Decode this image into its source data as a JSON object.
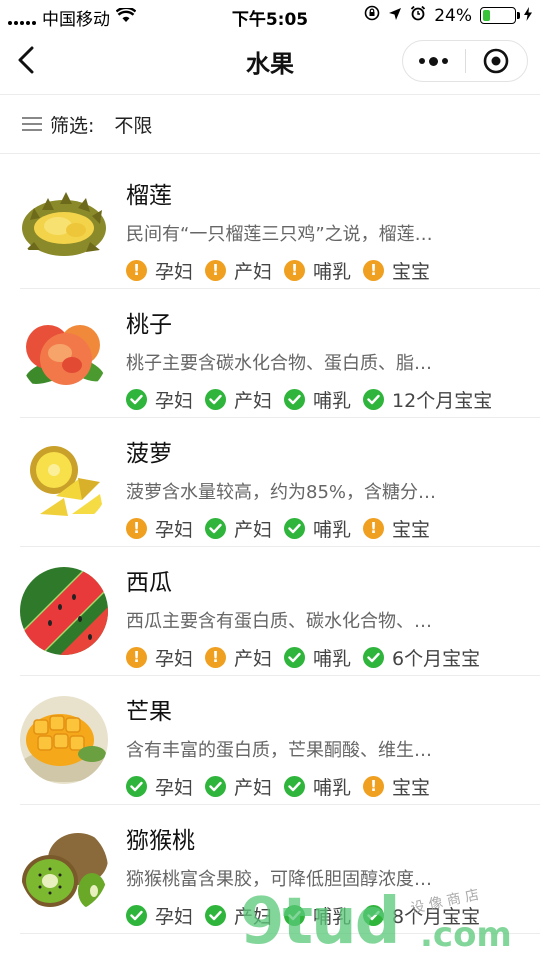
{
  "status_bar": {
    "carrier": "中国移动",
    "time": "下午5:05",
    "battery_percent": "24%",
    "battery_level": 0.24
  },
  "nav": {
    "title": "水果",
    "back_icon": "chevron-left-icon",
    "more_icon": "more-dots-icon",
    "close_icon": "target-circle-icon"
  },
  "filter": {
    "label": "筛选:",
    "value": "不限"
  },
  "colors": {
    "warn": "#f0a020",
    "ok": "#2fb43c"
  },
  "items": [
    {
      "name": "榴莲",
      "desc": "民间有“一只榴莲三只鸡”之说，榴莲…",
      "image": "durian",
      "tags": [
        {
          "label": "孕妇",
          "status": "warn"
        },
        {
          "label": "产妇",
          "status": "warn"
        },
        {
          "label": "哺乳",
          "status": "warn"
        },
        {
          "label": "宝宝",
          "status": "warn"
        }
      ]
    },
    {
      "name": "桃子",
      "desc": "桃子主要含碳水化合物、蛋白质、脂…",
      "image": "peach",
      "tags": [
        {
          "label": "孕妇",
          "status": "ok"
        },
        {
          "label": "产妇",
          "status": "ok"
        },
        {
          "label": "哺乳",
          "status": "ok"
        },
        {
          "label": "12个月宝宝",
          "status": "ok"
        }
      ]
    },
    {
      "name": "菠萝",
      "desc": "菠萝含水量较高，约为85%，含糖分…",
      "image": "pineapple",
      "tags": [
        {
          "label": "孕妇",
          "status": "warn"
        },
        {
          "label": "产妇",
          "status": "ok"
        },
        {
          "label": "哺乳",
          "status": "ok"
        },
        {
          "label": "宝宝",
          "status": "warn"
        }
      ]
    },
    {
      "name": "西瓜",
      "desc": "西瓜主要含有蛋白质、碳水化合物、…",
      "image": "watermelon",
      "tags": [
        {
          "label": "孕妇",
          "status": "warn"
        },
        {
          "label": "产妇",
          "status": "warn"
        },
        {
          "label": "哺乳",
          "status": "ok"
        },
        {
          "label": "6个月宝宝",
          "status": "ok"
        }
      ]
    },
    {
      "name": "芒果",
      "desc": "含有丰富的蛋白质，芒果酮酸、维生…",
      "image": "mango",
      "tags": [
        {
          "label": "孕妇",
          "status": "ok"
        },
        {
          "label": "产妇",
          "status": "ok"
        },
        {
          "label": "哺乳",
          "status": "ok"
        },
        {
          "label": "宝宝",
          "status": "warn"
        }
      ]
    },
    {
      "name": "猕猴桃",
      "desc": "猕猴桃富含果胶，可降低胆固醇浓度…",
      "image": "kiwi",
      "tags": [
        {
          "label": "孕妇",
          "status": "ok"
        },
        {
          "label": "产妇",
          "status": "ok"
        },
        {
          "label": "哺乳",
          "status": "ok"
        },
        {
          "label": "8个月宝宝",
          "status": "ok"
        }
      ]
    }
  ],
  "watermark": {
    "brand": "9tud",
    "suffix": ".com",
    "small": "设 像 商 店"
  }
}
